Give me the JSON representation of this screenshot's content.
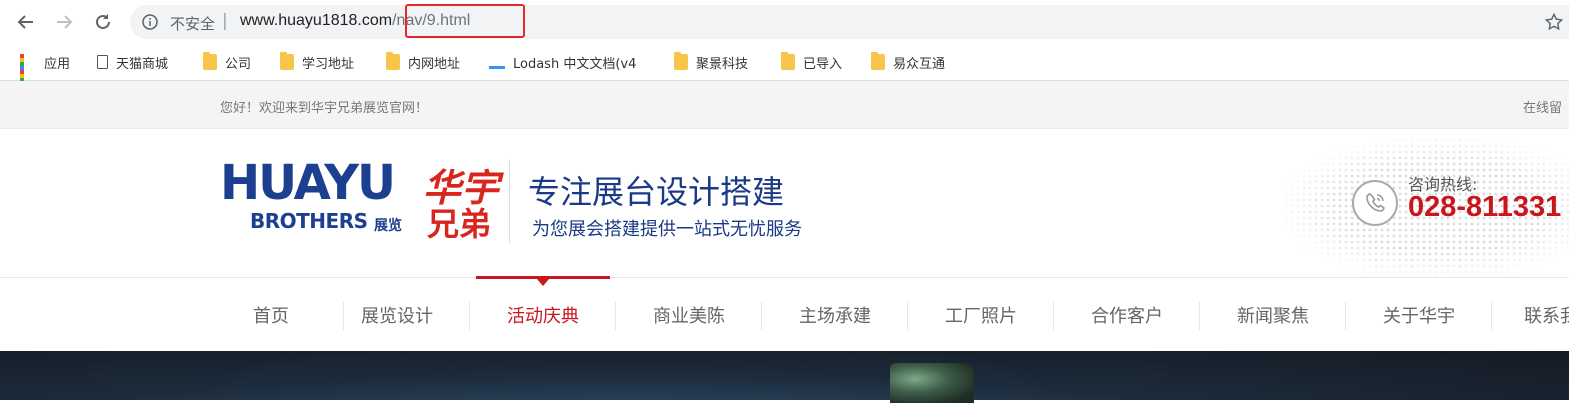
{
  "browser": {
    "security_label": "不安全",
    "separator": "|",
    "url_host": "www.huayu1818.com",
    "url_path": "/nav/9.html",
    "bookmarks": [
      {
        "label": "应用",
        "icon": "apps-grid-icon"
      },
      {
        "label": "天猫商城",
        "icon": "page-icon"
      },
      {
        "label": "公司",
        "icon": "folder-icon"
      },
      {
        "label": "学习地址",
        "icon": "folder-icon"
      },
      {
        "label": "内网地址",
        "icon": "folder-icon"
      },
      {
        "label": "Lodash 中文文档(v4",
        "icon": "lodash-icon"
      },
      {
        "label": "聚景科技",
        "icon": "folder-icon"
      },
      {
        "label": "已导入",
        "icon": "folder-icon"
      },
      {
        "label": "易众互通",
        "icon": "folder-icon"
      }
    ],
    "highlight_color": "#e3282c"
  },
  "site": {
    "topbar": {
      "welcome": "您好！欢迎来到华宇兄弟展览官网！",
      "message": "在线留"
    },
    "logo": {
      "en_main": "HUAYU",
      "en_sub": "BROTHERS",
      "cn_small": "展览",
      "cn_main": "华宇",
      "cn_sub": "兄弟"
    },
    "slogan": {
      "main": "专注展台设计搭建",
      "sub": "为您展会搭建提供一站式无忧服务"
    },
    "hotline": {
      "label": "咨询热线:",
      "number": "028-811331"
    },
    "nav": {
      "items": [
        "首页",
        "展览设计",
        "活动庆典",
        "商业美陈",
        "主场承建",
        "工厂照片",
        "合作客户",
        "新闻聚焦",
        "关于华宇",
        "联系我"
      ],
      "active_index": 2
    },
    "colors": {
      "brand_blue": "#1d3f8f",
      "brand_red": "#c8161d"
    }
  }
}
